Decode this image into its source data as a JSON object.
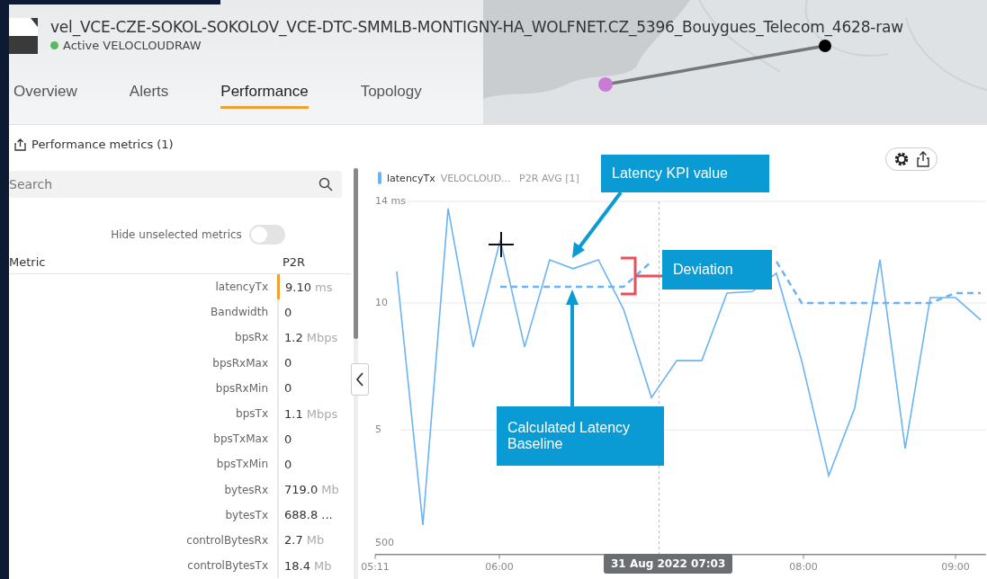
{
  "header": {
    "title": "vel_VCE-CZE-SOKOL-SOKOLOV_VCE-DTC-SMMLB-MONTIGNY-HA_WOLFNET.CZ_5396_Bouygues_Telecom_4628-raw",
    "status": "Active VELOCLOUDRAW",
    "online": true
  },
  "tabs": [
    {
      "label": "Overview",
      "selected": false
    },
    {
      "label": "Alerts",
      "selected": false
    },
    {
      "label": "Performance",
      "selected": true
    },
    {
      "label": "Topology",
      "selected": false
    }
  ],
  "metrics_panel": {
    "title": "Performance metrics (1)",
    "search": {
      "placeholder": "Search"
    },
    "hide_unselected": {
      "label": "Hide unselected metrics",
      "on": false
    },
    "columns": [
      "Metric",
      "P2R"
    ],
    "rows": [
      {
        "metric": "latencyTx",
        "value": "9.10",
        "unit": "ms",
        "selected": true
      },
      {
        "metric": "Bandwidth",
        "value": "0",
        "selected": false
      },
      {
        "metric": "bpsRx",
        "value": "1.2",
        "unit": "Mbps",
        "selected": false
      },
      {
        "metric": "bpsRxMax",
        "value": "0",
        "selected": false
      },
      {
        "metric": "bpsRxMin",
        "value": "0",
        "selected": false
      },
      {
        "metric": "bpsTx",
        "value": "1.1",
        "unit": "Mbps",
        "selected": false
      },
      {
        "metric": "bpsTxMax",
        "value": "0",
        "selected": false
      },
      {
        "metric": "bpsTxMin",
        "value": "0",
        "selected": false
      },
      {
        "metric": "bytesRx",
        "value": "719.0",
        "unit": "Mb",
        "selected": false
      },
      {
        "metric": "bytesTx",
        "value": "688.8 ...",
        "selected": false
      },
      {
        "metric": "controlBytesRx",
        "value": "2.7",
        "unit": "Mb",
        "selected": false
      },
      {
        "metric": "controlBytesTx",
        "value": "18.4",
        "unit": "Mb",
        "selected": false
      }
    ]
  },
  "chart": {
    "legend": {
      "source": "VELOCLOUD...",
      "aggregate": "P2R AVG [1]"
    },
    "cursor_label": "31 Aug 2022 07:03",
    "y_min_label": "500",
    "callouts": [
      {
        "text": "Latency KPI value",
        "kind": "arrow"
      },
      {
        "text": "Deviation",
        "kind": "bracket"
      },
      {
        "text": "Calculated Latency Baseline",
        "kind": "arrow"
      }
    ],
    "chart_data": {
      "type": "line",
      "x": [
        5.325,
        5.497,
        5.663,
        5.828,
        6.006,
        6.166,
        6.331,
        6.485,
        6.651,
        6.817,
        7.0,
        7.166,
        7.331,
        7.497,
        7.663,
        7.822,
        7.988,
        8.166,
        8.337,
        8.503,
        8.669,
        8.834,
        9.0,
        9.166
      ],
      "series": [
        {
          "name": "latencyTx",
          "color": "#6ab4f5",
          "values": [
            11.24,
            1.26,
            13.72,
            8.27,
            12.48,
            8.27,
            11.7,
            11.35,
            11.7,
            9.75,
            6.28,
            7.73,
            7.73,
            10.39,
            10.45,
            11.17,
            7.73,
            3.2,
            5.86,
            11.7,
            4.27,
            10.21,
            10.21,
            9.33
          ]
        },
        {
          "color": "#6ab4f5",
          "line_style": "dashed",
          "values": [
            null,
            null,
            null,
            null,
            10.64,
            10.64,
            10.64,
            10.64,
            10.64,
            10.64,
            11.63,
            null,
            null,
            null,
            null,
            11.63,
            10.0,
            10.0,
            10.0,
            10.0,
            10.0,
            10.0,
            10.39,
            10.39
          ]
        }
      ],
      "ref_lines": [
        {
          "axis": "x",
          "value": 7.05
        }
      ],
      "xlim": [
        5.1833,
        9.2
      ],
      "ylim": [
        0.1,
        14
      ],
      "xticks": [
        {
          "value": 5.1833,
          "label": "05:11"
        },
        {
          "value": 6,
          "label": "06:00"
        },
        {
          "value": 8,
          "label": "08:00"
        },
        {
          "value": 9,
          "label": "09:00"
        }
      ],
      "yticks": [
        {
          "value": 14,
          "label": "14 ms"
        },
        10,
        5
      ]
    }
  }
}
